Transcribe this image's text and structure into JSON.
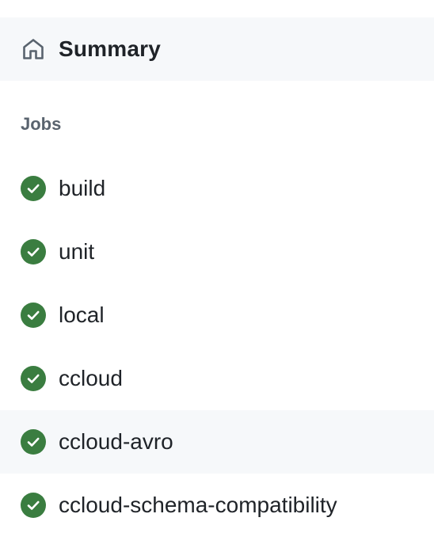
{
  "summary": {
    "label": "Summary",
    "icon": "home-icon"
  },
  "jobs": {
    "heading": "Jobs",
    "status_color": "#3a7d40",
    "items": [
      {
        "label": "build",
        "status": "success",
        "icon": "check-circle-icon"
      },
      {
        "label": "unit",
        "status": "success",
        "icon": "check-circle-icon"
      },
      {
        "label": "local",
        "status": "success",
        "icon": "check-circle-icon"
      },
      {
        "label": "ccloud",
        "status": "success",
        "icon": "check-circle-icon"
      },
      {
        "label": "ccloud-avro",
        "status": "success",
        "icon": "check-circle-icon",
        "selected": true
      },
      {
        "label": "ccloud-schema-compatibility",
        "status": "success",
        "icon": "check-circle-icon"
      }
    ]
  }
}
